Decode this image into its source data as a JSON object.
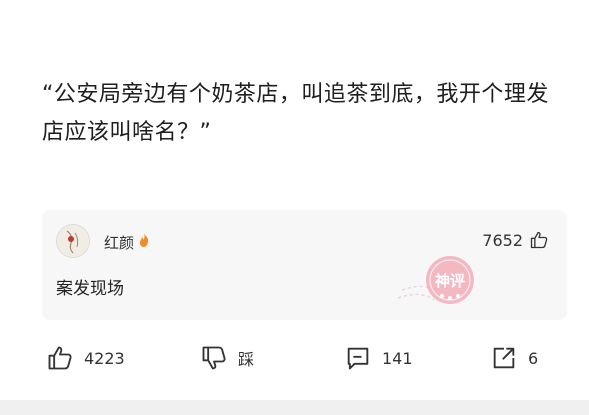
{
  "post": {
    "text": "“公安局旁边有个奶茶店，叫追茶到底，我开个理发\n店应该叫啥名？”"
  },
  "hot_comment": {
    "username": "红颜",
    "like_count": "7652",
    "text": "案发现场",
    "stamp_text": "神评"
  },
  "actions": {
    "like_count": "4223",
    "dislike_label": "踩",
    "comment_count": "141",
    "share_count": "6"
  },
  "colors": {
    "stamp": "#e8637a",
    "card_bg": "#f7f7f7",
    "fire": "#f08c2a"
  },
  "icons": [
    "thumbs-up-icon",
    "thumbs-down-icon",
    "comment-icon",
    "share-icon",
    "fire-icon"
  ]
}
